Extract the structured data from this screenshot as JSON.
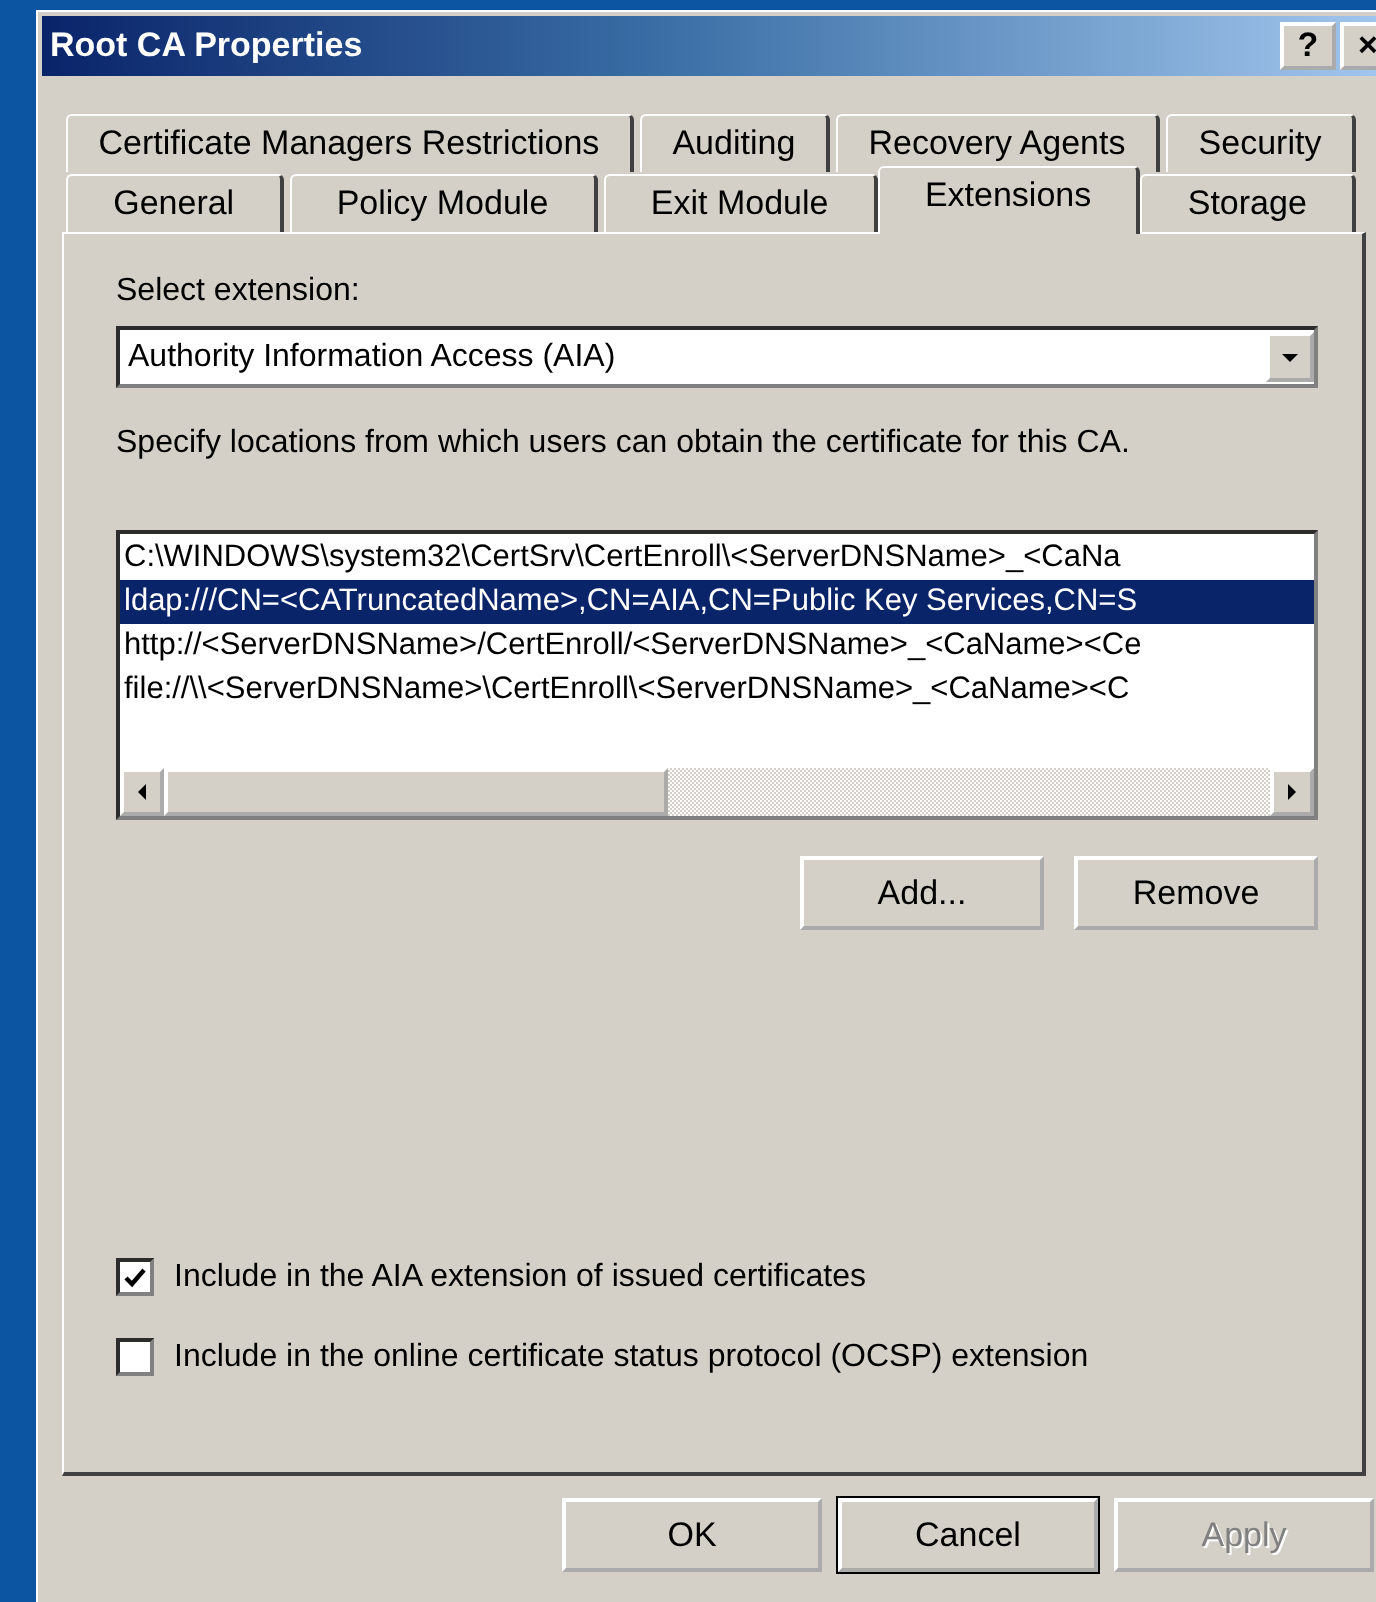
{
  "window": {
    "title": "Root CA Properties",
    "title_buttons": [
      "?",
      "×"
    ]
  },
  "tab_rows": [
    [
      {
        "label": "Certificate Managers Restrictions",
        "selected": false
      },
      {
        "label": "Auditing",
        "selected": false
      },
      {
        "label": "Recovery Agents",
        "selected": false
      },
      {
        "label": "Security",
        "selected": false
      }
    ],
    [
      {
        "label": "General",
        "selected": false
      },
      {
        "label": "Policy Module",
        "selected": false
      },
      {
        "label": "Exit Module",
        "selected": false
      },
      {
        "label": "Extensions",
        "selected": true
      },
      {
        "label": "Storage",
        "selected": false
      }
    ]
  ],
  "extension_select": {
    "label": "Select extension:",
    "value": "Authority Information Access (AIA)"
  },
  "description": "Specify locations from which users can obtain the certificate for this CA.",
  "locations": [
    {
      "text": "C:\\WINDOWS\\system32\\CertSrv\\CertEnroll\\<ServerDNSName>_<CaNa",
      "selected": false
    },
    {
      "text": "ldap:///CN=<CATruncatedName>,CN=AIA,CN=Public Key Services,CN=S",
      "selected": true
    },
    {
      "text": "http://<ServerDNSName>/CertEnroll/<ServerDNSName>_<CaName><Ce",
      "selected": false
    },
    {
      "text": "file://\\\\<ServerDNSName>\\CertEnroll\\<ServerDNSName>_<CaName><C",
      "selected": false
    }
  ],
  "list_buttons": [
    {
      "label": "Add..."
    },
    {
      "label": "Remove"
    }
  ],
  "options": [
    {
      "label": "Include in the AIA extension of issued certificates",
      "checked": true
    },
    {
      "label": "Include in the online certificate status protocol (OCSP) extension",
      "checked": false
    }
  ],
  "buttons": [
    {
      "label": "OK",
      "default": false,
      "disabled": false
    },
    {
      "label": "Cancel",
      "default": true,
      "disabled": false
    },
    {
      "label": "Apply",
      "default": false,
      "disabled": true
    }
  ]
}
